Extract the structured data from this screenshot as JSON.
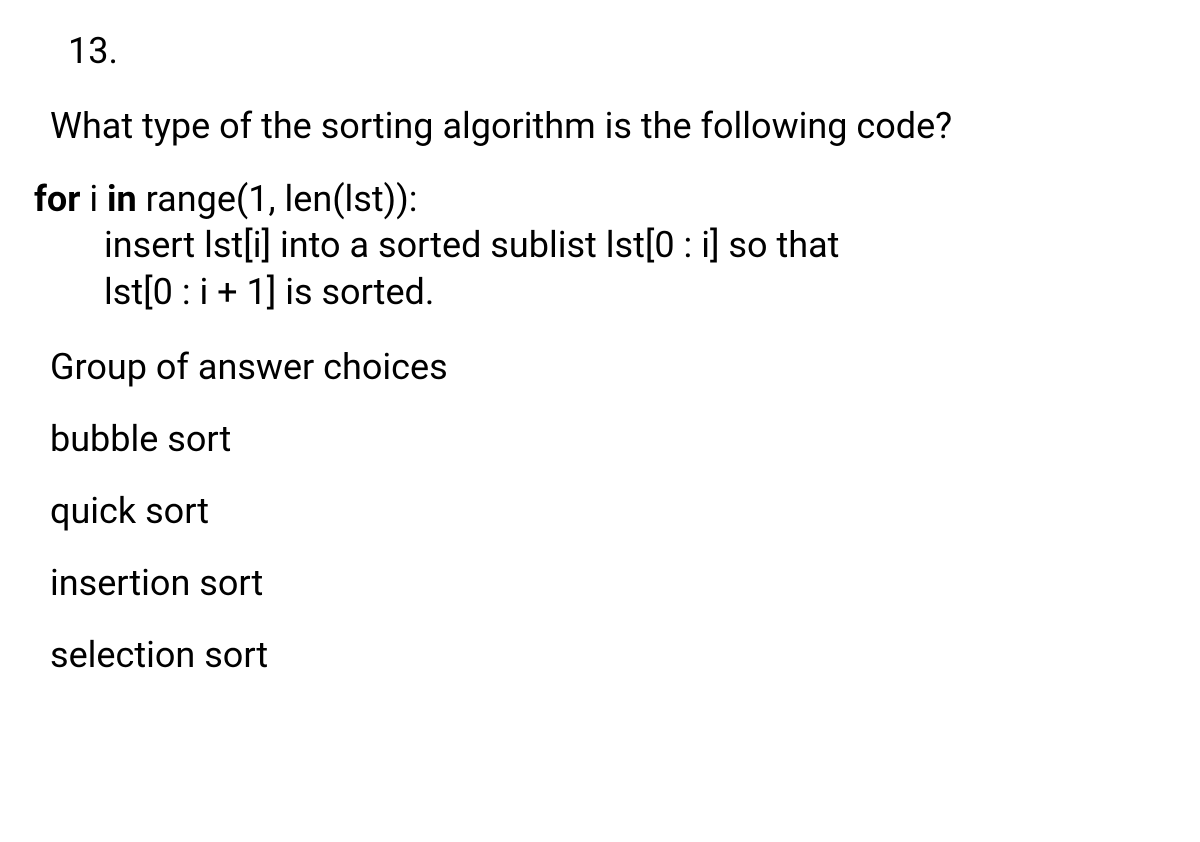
{
  "question": {
    "number": "13.",
    "text": "What type of the sorting algorithm is the following code?",
    "code": {
      "line1_bold1": "for",
      "line1_mid": " i ",
      "line1_bold2": "in",
      "line1_rest": " range(1, len(lst)):",
      "line2": "insert lst[i] into a sorted sublist lst[0 : i] so that",
      "line3": "lst[0 : i + 1] is sorted."
    },
    "choices_header": "Group of answer choices",
    "choices": [
      "bubble sort",
      "quick sort",
      "insertion sort",
      "selection sort"
    ]
  }
}
